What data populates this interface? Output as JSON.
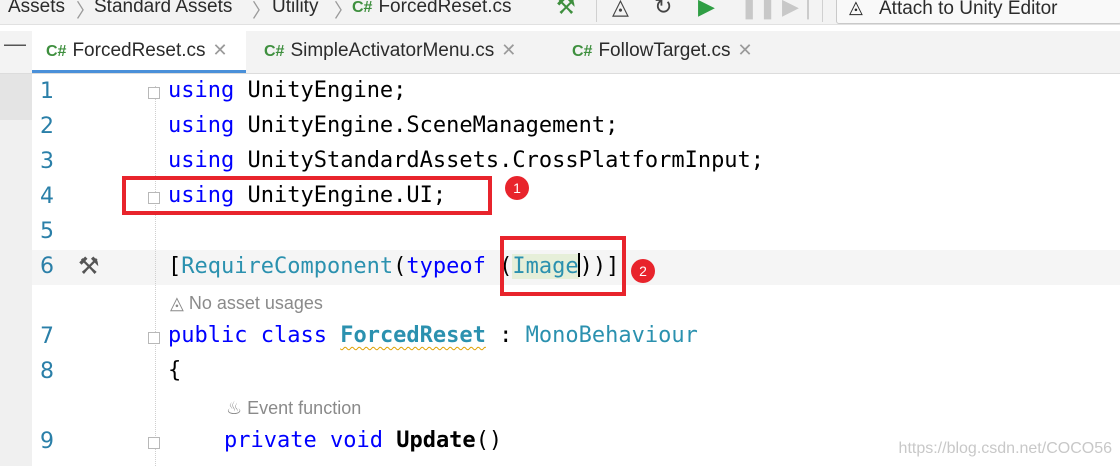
{
  "breadcrumb": {
    "items": [
      "Assets",
      "Standard Assets",
      "Utility",
      "ForcedReset.cs"
    ],
    "file_lang_badge": "C#"
  },
  "toolbar": {
    "attach_label": "Attach to Unity Editor",
    "icons": [
      "hammer-icon",
      "unity-icon",
      "refresh-icon",
      "play-icon",
      "pause-icon",
      "step-icon"
    ]
  },
  "tabs": [
    {
      "lang": "C#",
      "label": "ForcedReset.cs",
      "active": true
    },
    {
      "lang": "C#",
      "label": "SimpleActivatorMenu.cs",
      "active": false
    },
    {
      "lang": "C#",
      "label": "FollowTarget.cs",
      "active": false
    }
  ],
  "editor": {
    "lines": [
      {
        "num": "1",
        "tokens": [
          [
            "kw",
            "using"
          ],
          [
            "",
            "UnityEngine;"
          ]
        ]
      },
      {
        "num": "2",
        "tokens": [
          [
            "kw",
            "using"
          ],
          [
            "",
            "UnityEngine.SceneManagement;"
          ]
        ]
      },
      {
        "num": "3",
        "tokens": [
          [
            "kw",
            "using"
          ],
          [
            "",
            "UnityStandardAssets.CrossPlatformInput;"
          ]
        ]
      },
      {
        "num": "4",
        "tokens": [
          [
            "kw",
            "using"
          ],
          [
            "",
            "UnityEngine.UI;"
          ]
        ]
      },
      {
        "num": "5",
        "tokens": []
      },
      {
        "num": "6",
        "tokens": [
          [
            "",
            "["
          ],
          [
            "ty",
            "RequireComponent"
          ],
          [
            "",
            "("
          ],
          [
            "kw",
            "typeof"
          ],
          [
            "",
            " ("
          ],
          [
            "ty",
            "Image"
          ],
          [
            "",
            ")"
          ],
          [
            "",
            ")]"
          ]
        ]
      },
      {
        "num": "7",
        "tokens": [
          [
            "kw",
            "public class"
          ],
          [
            "cls",
            "ForcedReset"
          ],
          [
            "",
            " : "
          ],
          [
            "ty",
            "MonoBehaviour"
          ]
        ]
      },
      {
        "num": "8",
        "tokens": [
          [
            "",
            "{"
          ]
        ]
      },
      {
        "num": "9",
        "tokens": [
          [
            "kw",
            "private void"
          ],
          [
            "bold",
            "Update"
          ],
          [
            "",
            "()"
          ]
        ]
      }
    ],
    "hint_asset_usages": "No asset usages",
    "hint_event_function": "Event function"
  },
  "annotations": {
    "badge1": "1",
    "badge2": "2",
    "accent": "#e8242c"
  },
  "watermark": "https://blog.csdn.net/COCO56"
}
